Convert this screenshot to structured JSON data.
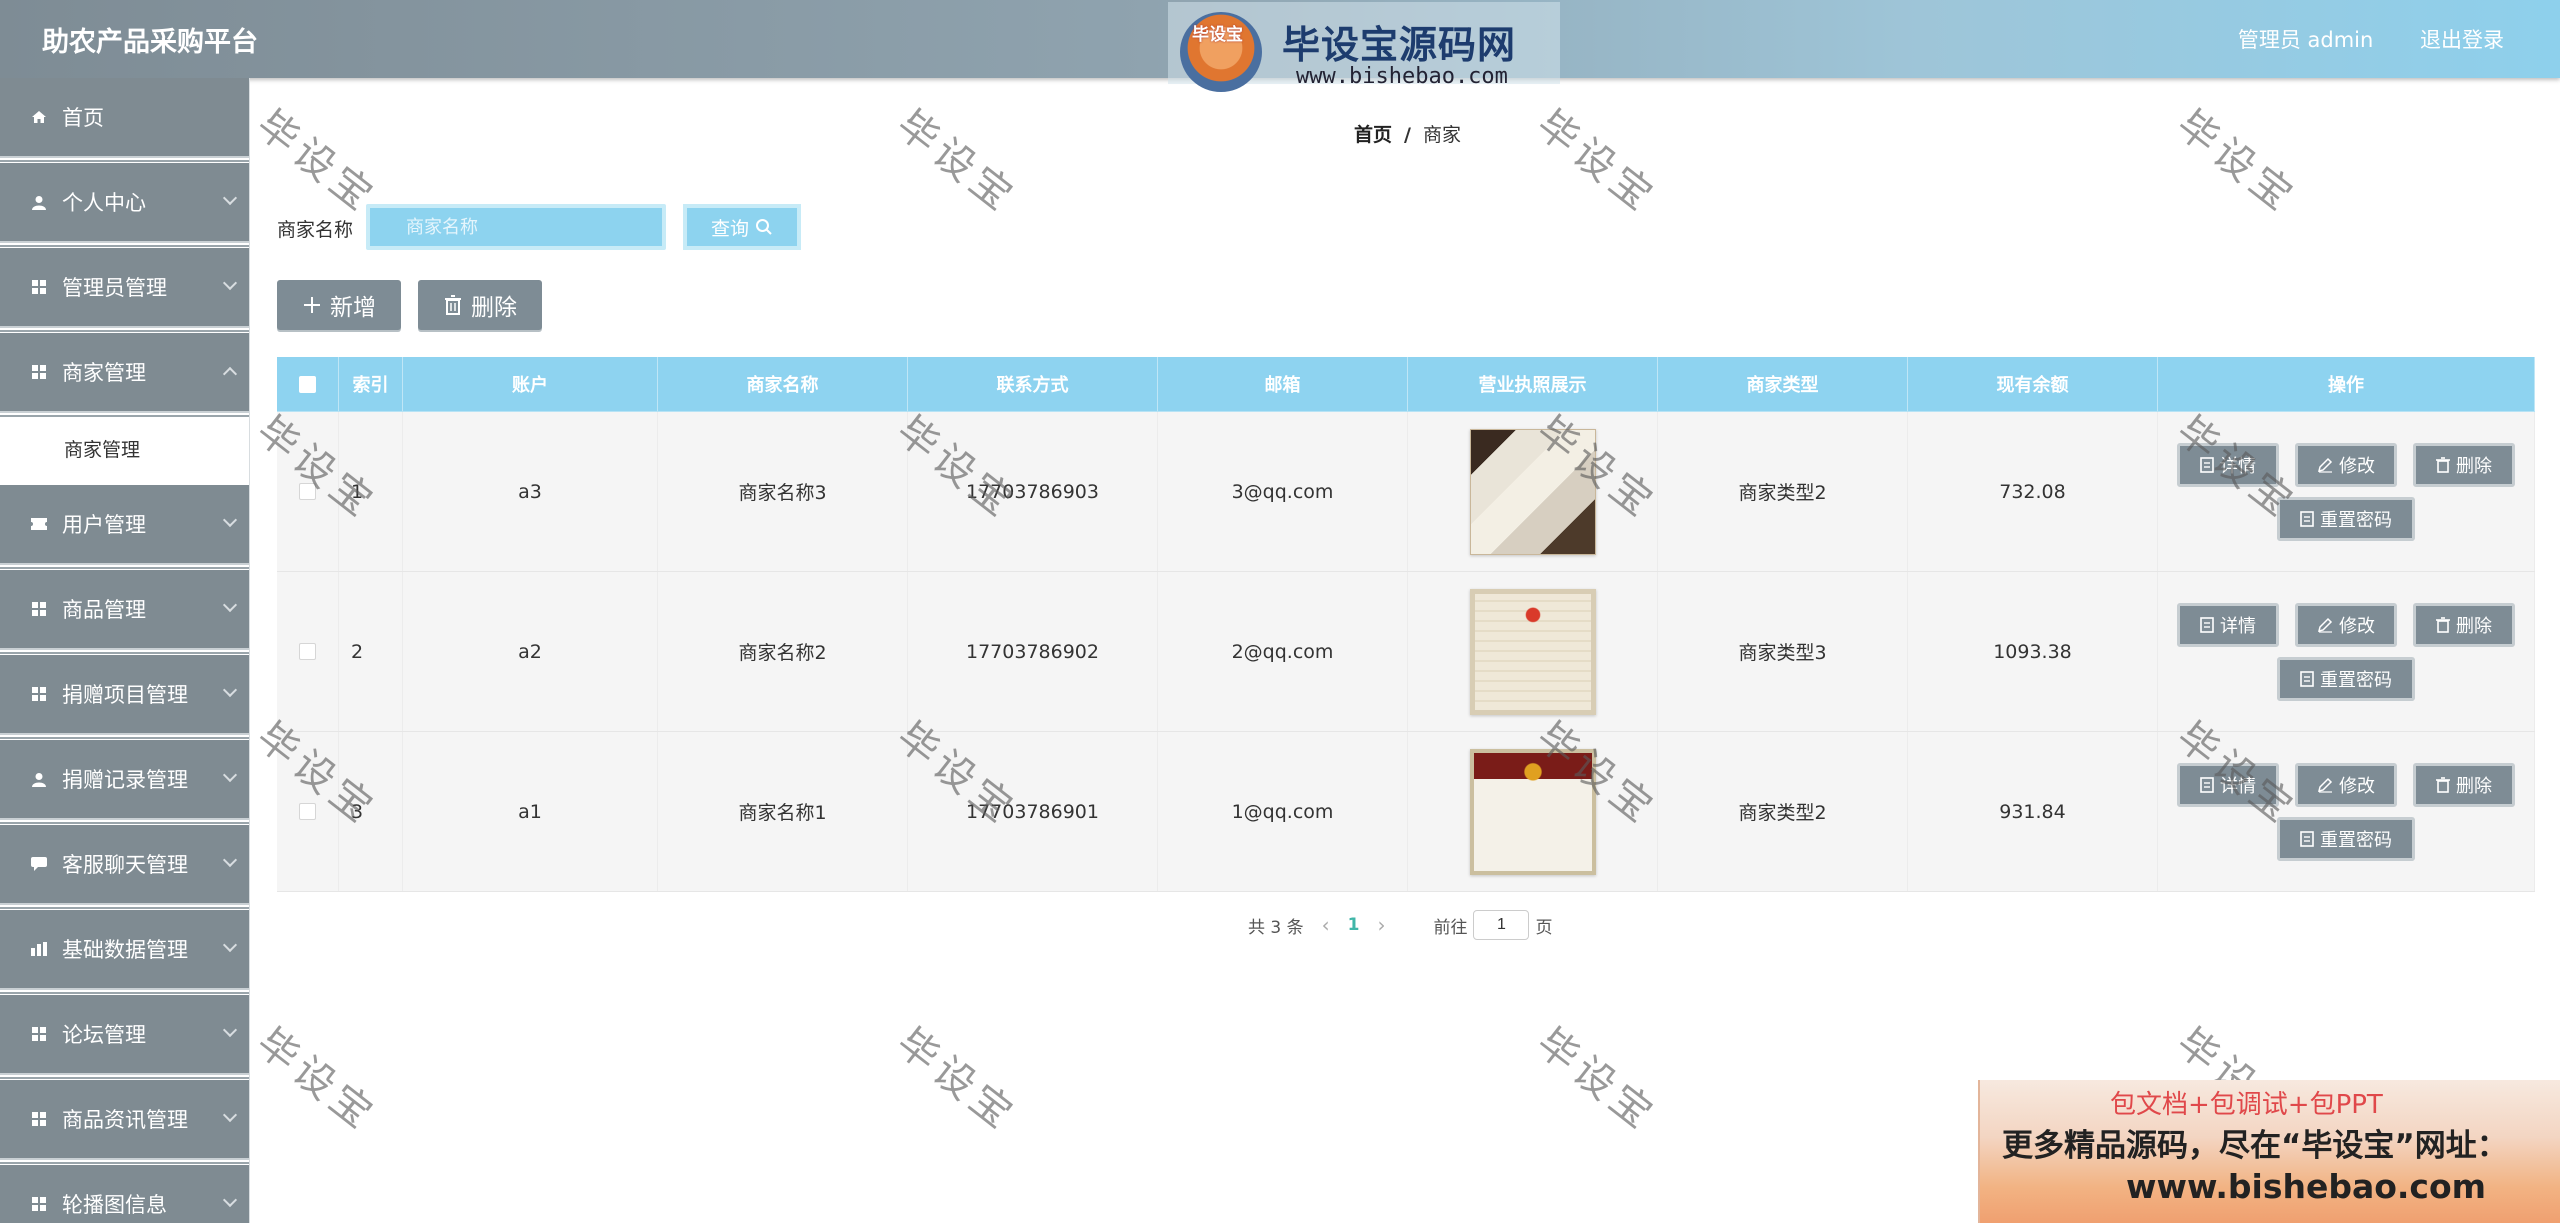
{
  "header": {
    "title": "助农产品采购平台",
    "user_label": "管理员 admin",
    "logout_label": "退出登录"
  },
  "watermark": {
    "logo_badge": "毕设宝",
    "brand": "毕设宝源码网",
    "url": "www.bishebao.com",
    "stamp": "毕设宝"
  },
  "sidebar": {
    "items": [
      {
        "label": "首页",
        "icon": "home-icon"
      },
      {
        "label": "个人中心",
        "icon": "user-icon"
      },
      {
        "label": "管理员管理",
        "icon": "grid-icon"
      },
      {
        "label": "商家管理",
        "icon": "grid-icon",
        "sub": "商家管理"
      },
      {
        "label": "用户管理",
        "icon": "ticket-icon"
      },
      {
        "label": "商品管理",
        "icon": "grid-icon"
      },
      {
        "label": "捐赠项目管理",
        "icon": "grid-icon"
      },
      {
        "label": "捐赠记录管理",
        "icon": "user-icon"
      },
      {
        "label": "客服聊天管理",
        "icon": "chat-icon"
      },
      {
        "label": "基础数据管理",
        "icon": "chart-icon"
      },
      {
        "label": "论坛管理",
        "icon": "grid-icon"
      },
      {
        "label": "商品资讯管理",
        "icon": "grid-icon"
      },
      {
        "label": "轮播图信息",
        "icon": "grid-icon"
      }
    ]
  },
  "breadcrumb": {
    "home": "首页",
    "current": "商家"
  },
  "search": {
    "label": "商家名称",
    "placeholder": "商家名称",
    "button": "查询"
  },
  "toolbar": {
    "add_label": "新增",
    "delete_label": "删除"
  },
  "table": {
    "columns": [
      "索引",
      "账户",
      "商家名称",
      "联系方式",
      "邮箱",
      "营业执照展示",
      "商家类型",
      "现有余额",
      "操作"
    ],
    "rows": [
      {
        "index": "1",
        "account": "a3",
        "name": "商家名称3",
        "phone": "17703786903",
        "email": "3@qq.com",
        "type": "商家类型2",
        "balance": "732.08"
      },
      {
        "index": "2",
        "account": "a2",
        "name": "商家名称2",
        "phone": "17703786902",
        "email": "2@qq.com",
        "type": "商家类型3",
        "balance": "1093.38"
      },
      {
        "index": "3",
        "account": "a1",
        "name": "商家名称1",
        "phone": "17703786901",
        "email": "1@qq.com",
        "type": "商家类型2",
        "balance": "931.84"
      }
    ],
    "actions": {
      "detail": "详情",
      "edit": "修改",
      "delete": "删除",
      "reset_password": "重置密码"
    }
  },
  "pagination": {
    "total": "共 3 条",
    "current_page": "1",
    "goto_prefix": "前往",
    "goto_value": "1",
    "goto_suffix": "页"
  },
  "ad": {
    "line1": "包文档+包调试+包PPT",
    "line2": "更多精品源码，尽在“毕设宝”网址：",
    "line3": "www.bishebao.com"
  }
}
